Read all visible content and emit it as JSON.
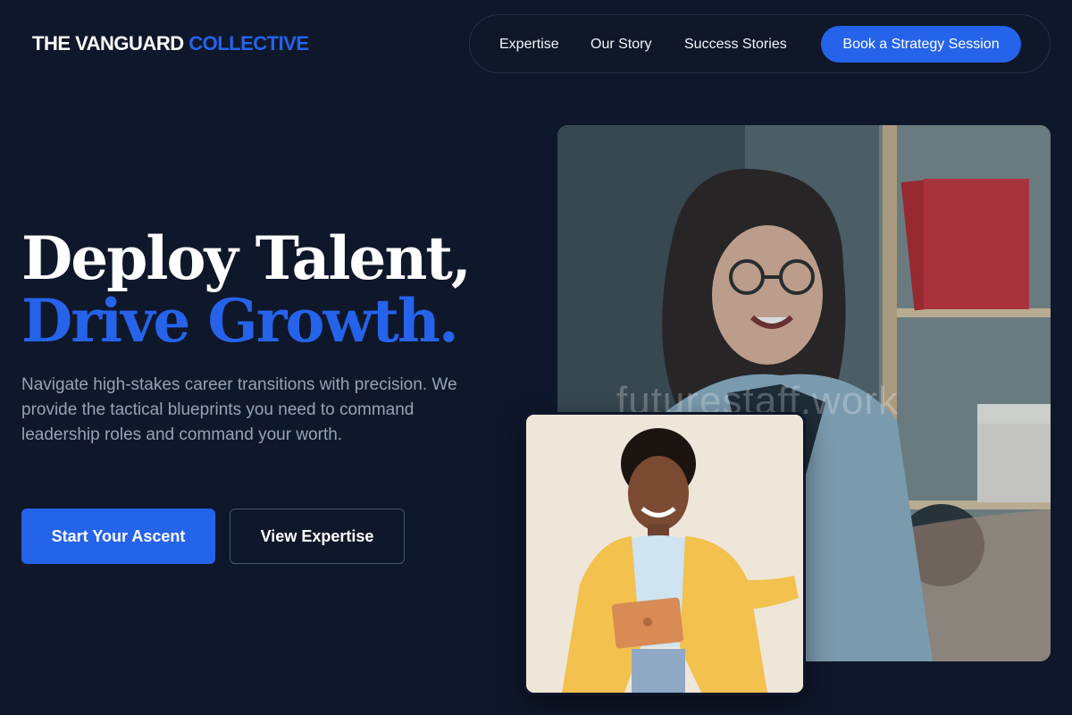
{
  "brand": {
    "name_primary": "THE VANGUARD",
    "name_accent": "COLLECTIVE"
  },
  "nav": {
    "links": [
      {
        "label": "Expertise"
      },
      {
        "label": "Our Story"
      },
      {
        "label": "Success Stories"
      }
    ],
    "cta_label": "Book a Strategy Session"
  },
  "hero": {
    "headline_line1": "Deploy Talent,",
    "headline_line2": "Drive Growth.",
    "lead": "Navigate high-stakes career transitions with precision. We provide the tactical blueprints you need to command leadership roles and command your worth.",
    "primary_cta": "Start Your Ascent",
    "secondary_cta": "View Expertise"
  },
  "media": {
    "main_photo_watermark": "futurestaff.work"
  },
  "colors": {
    "background": "#0f172a",
    "accent": "#2563eb",
    "muted_text": "#94a3b8"
  }
}
